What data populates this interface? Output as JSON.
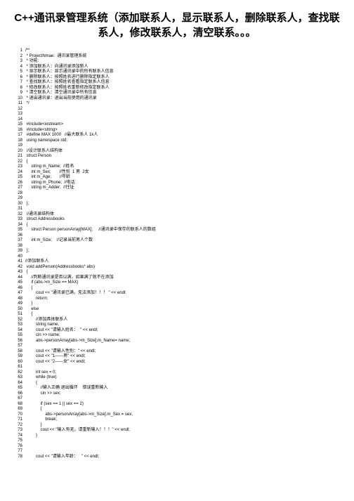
{
  "title": "C++通讯录管理系统（添加联系人，显示联系人，删除联系人，查找联系人，修改联系人，清空联系。。。",
  "code_lines": [
    "/**",
    " * ProjectNmae:  通讯录管理系统",
    " * 功能:",
    " * 添加联系人：向通讯录添加新人",
    " * 显示联系人：显示通讯录中的所有联系人信息",
    " * 删除联系人：按照姓名进行删除指定联系人",
    " * 查找联系人：按照姓名查看指定联系人信息",
    " * 修改联系人：按照姓名重新修改指定联系人",
    " * 清空联系人：清空通讯录中所有信息",
    " * 退出通讯录：退出当前使用的通讯录",
    " */",
    "",
    "",
    "",
    " #include<iostream>",
    " #include<string>",
    " #define MAX 1000   //最大联系人 1k人",
    " using namespace std;",
    "",
    " //设计联系人结构体",
    " struct Person",
    " {",
    "     string m_Name;  //姓名",
    "     int m_Sex;       //性别  1 男  2女",
    "     int m_Age;       //年龄",
    "     string m_Phone;  //电话",
    "     string m_Adder;  //住址",
    "",
    "",
    " };",
    "",
    " //通讯录结构体",
    " struct Addressbooks",
    " {",
    "     struct Person personArray[MAX];     //通讯录中保存的联系人的数组",
    "",
    "     int m_Size;    //记录当前男人个数",
    "",
    " };",
    "",
    "//添加联系人",
    " void addPerson(Addressbooks* abs)",
    " {",
    "     //判断通讯录是否以满，如果满了就不在添加",
    "     if (abs->m_Size == MAX)",
    "     {",
    "         cout << \"通讯录已满，无法添加！！！ \" << endl;",
    "         return;",
    "     }",
    "     else",
    "     {",
    "         //添加具体联系人",
    "         string name;",
    "         cout << \"请输入姓名：  \" << endl;",
    "         cin >> name;",
    "         abs->personArray[abs->m_Size].m_Name= name;",
    "",
    "         cout << \"请输入性别：\" << endl;",
    "         cout << \"1------男\" << endl;",
    "         cout << \"2------女\" << endl;",
    "",
    "         int sex = 0;",
    "         while (true)",
    "         {",
    "             //输入正确 退出循环    错误重新输入",
    "             cin >> sex;",
    "",
    "             if (sex == 1 || sex == 2)",
    "             {",
    "                 abs->personArray[abs->m_Size].m_Sex = sex;",
    "                 break;",
    "             }",
    "             cout << \"输入有无，请重新输入！！！\" << endl;",
    "         }",
    "",
    "",
    "",
    "         cout << \"请输入年龄：   \" << endl;"
  ]
}
